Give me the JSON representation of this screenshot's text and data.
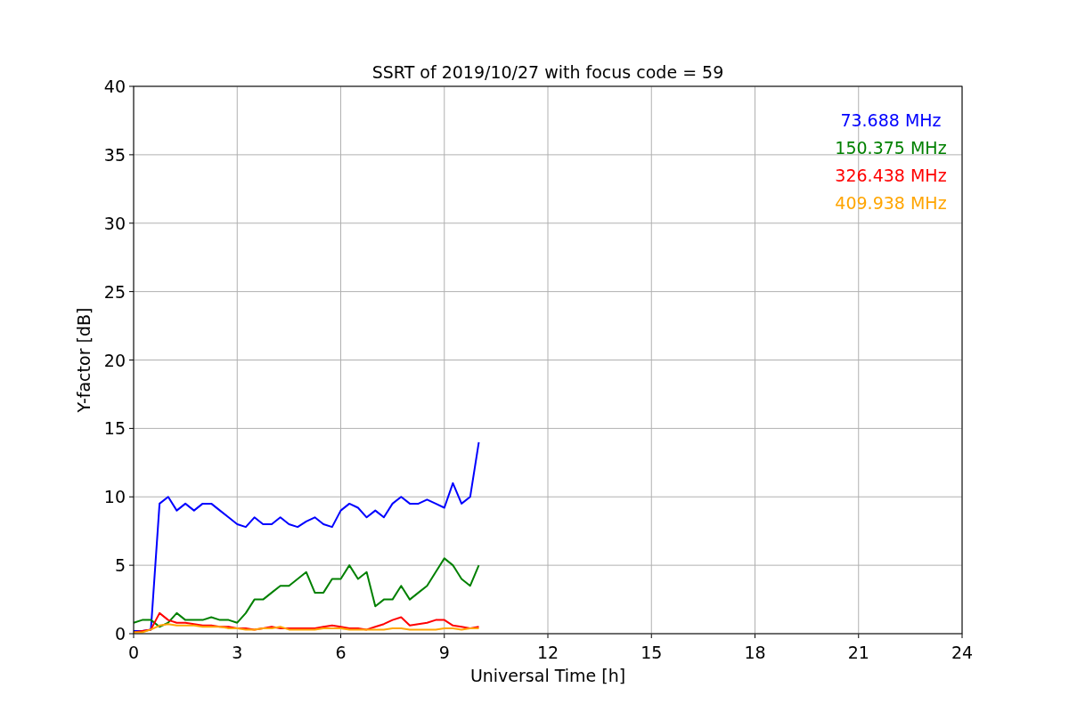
{
  "chart_data": {
    "type": "line",
    "title": "SSRT of 2019/10/27 with focus code = 59",
    "xlabel": "Universal Time [h]",
    "ylabel": "Y-factor [dB]",
    "x": [
      0,
      0.25,
      0.5,
      0.75,
      1,
      1.25,
      1.5,
      1.75,
      2,
      2.25,
      2.5,
      2.75,
      3,
      3.25,
      3.5,
      3.75,
      4,
      4.25,
      4.5,
      4.75,
      5,
      5.25,
      5.5,
      5.75,
      6,
      6.25,
      6.5,
      6.75,
      7,
      7.25,
      7.5,
      7.75,
      8,
      8.25,
      8.5,
      8.75,
      9,
      9.25,
      9.5,
      9.75,
      10
    ],
    "series": [
      {
        "name": "73.688 MHz",
        "color": "#0000ff",
        "values": [
          0.2,
          0.2,
          0.3,
          9.5,
          10,
          9,
          9.5,
          9,
          9.5,
          9.5,
          9,
          8.5,
          8,
          7.8,
          8.5,
          8,
          8,
          8.5,
          8,
          7.8,
          8.2,
          8.5,
          8,
          7.8,
          9,
          9.5,
          9.2,
          8.5,
          9,
          8.5,
          9.5,
          10,
          9.5,
          9.5,
          9.8,
          9.5,
          9.2,
          11,
          9.5,
          10,
          14
        ]
      },
      {
        "name": "150.375 MHz",
        "color": "#008000",
        "values": [
          0.8,
          1,
          1,
          0.5,
          0.8,
          1.5,
          1,
          1,
          1,
          1.2,
          1,
          1,
          0.8,
          1.5,
          2.5,
          2.5,
          3,
          3.5,
          3.5,
          4,
          4.5,
          3,
          3,
          4,
          4,
          5,
          4,
          4.5,
          2,
          2.5,
          2.5,
          3.5,
          2.5,
          3,
          3.5,
          4.5,
          5.5,
          5,
          4,
          3.5,
          5
        ]
      },
      {
        "name": "326.438 MHz",
        "color": "#ff0000",
        "values": [
          0.1,
          0.2,
          0.3,
          1.5,
          1,
          0.8,
          0.8,
          0.7,
          0.6,
          0.6,
          0.5,
          0.5,
          0.4,
          0.4,
          0.3,
          0.4,
          0.5,
          0.4,
          0.4,
          0.4,
          0.4,
          0.4,
          0.5,
          0.6,
          0.5,
          0.4,
          0.4,
          0.3,
          0.5,
          0.7,
          1,
          1.2,
          0.6,
          0.7,
          0.8,
          1,
          1,
          0.6,
          0.5,
          0.4,
          0.5
        ]
      },
      {
        "name": "409.938 MHz",
        "color": "#ffa500",
        "values": [
          0.1,
          0.1,
          0.3,
          0.6,
          0.7,
          0.6,
          0.6,
          0.6,
          0.5,
          0.5,
          0.5,
          0.4,
          0.4,
          0.3,
          0.3,
          0.4,
          0.4,
          0.5,
          0.3,
          0.3,
          0.3,
          0.3,
          0.4,
          0.4,
          0.4,
          0.3,
          0.3,
          0.3,
          0.3,
          0.3,
          0.4,
          0.4,
          0.3,
          0.3,
          0.3,
          0.3,
          0.4,
          0.4,
          0.3,
          0.4,
          0.4
        ]
      }
    ],
    "xlim": [
      0,
      24
    ],
    "ylim": [
      0,
      40
    ],
    "grid": true,
    "xticks": [
      0,
      3,
      6,
      9,
      12,
      15,
      18,
      21,
      24
    ],
    "yticks": [
      0,
      5,
      10,
      15,
      20,
      25,
      30,
      35,
      40
    ]
  }
}
